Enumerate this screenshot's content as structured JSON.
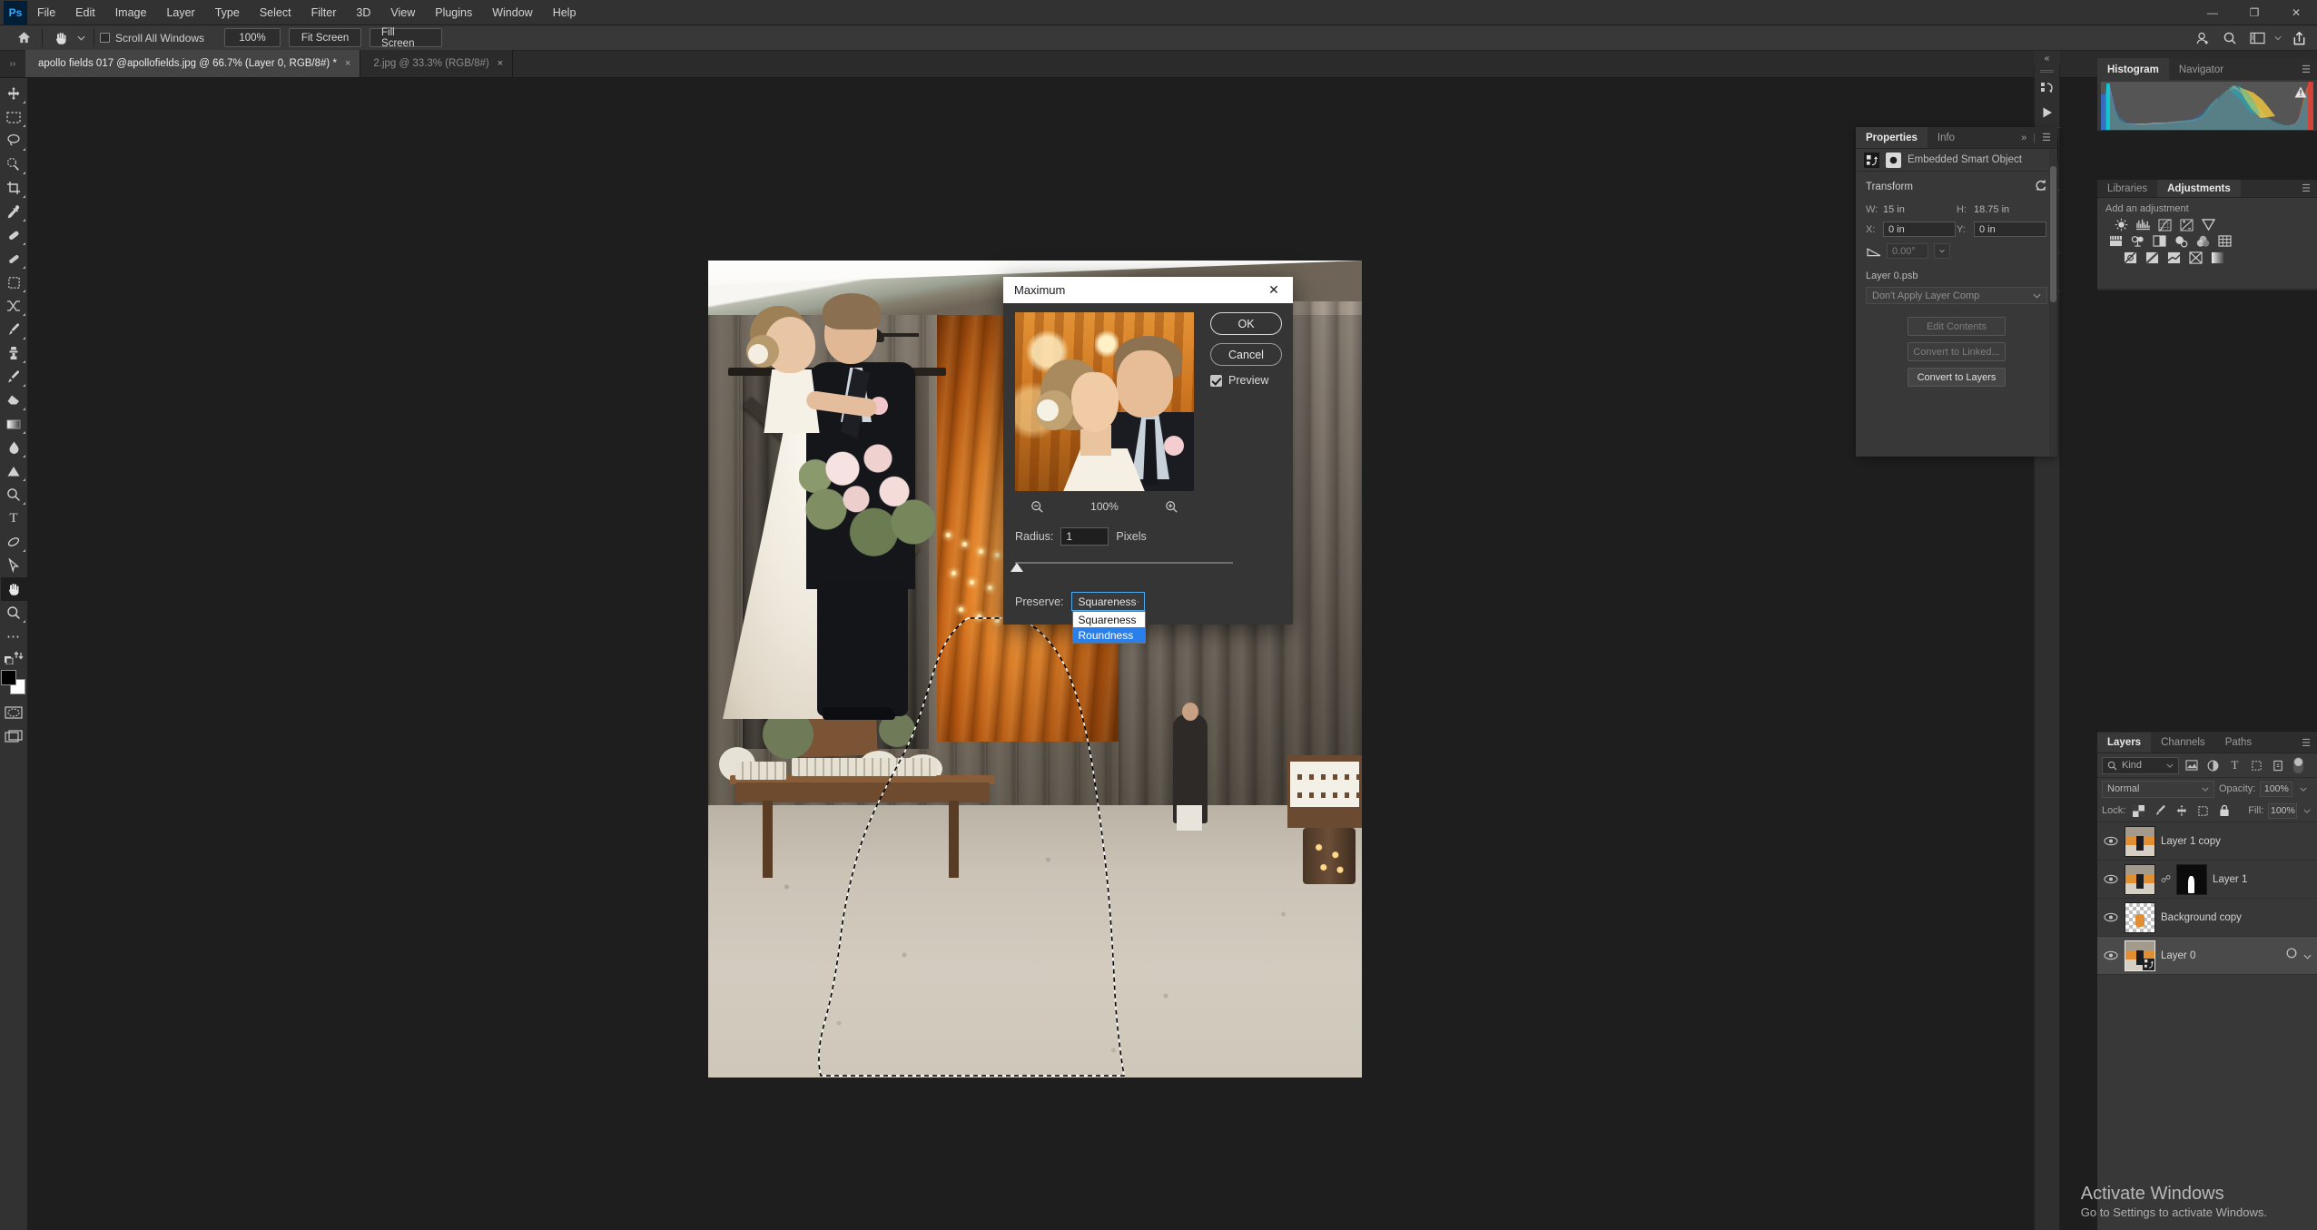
{
  "app": {
    "logo": "Ps"
  },
  "menubar": {
    "items": [
      "File",
      "Edit",
      "Image",
      "Layer",
      "Type",
      "Select",
      "Filter",
      "3D",
      "View",
      "Plugins",
      "Window",
      "Help"
    ],
    "window_controls": [
      "minimize-icon",
      "restore-icon",
      "close-icon"
    ]
  },
  "options_bar": {
    "home_icon": "home-icon",
    "tool_icon": "hand-tool-icon",
    "tool_preset_chevron": "chevron-down-icon",
    "scroll_all_windows_label": "Scroll All Windows",
    "scroll_all_windows_checked": false,
    "zoom_button": "100%",
    "fit_screen_button": "Fit Screen",
    "fill_screen_button": "Fill Screen",
    "right_icons": [
      "add-user-icon",
      "search-icon",
      "workspace-icon",
      "chevron-down-icon",
      "share-icon"
    ]
  },
  "tabs": [
    {
      "label": "apollo fields 017 @apollofields.jpg @ 66.7% (Layer 0, RGB/8#) *",
      "active": true,
      "close": "×"
    },
    {
      "label": "2.jpg @ 33.3% (RGB/8#)",
      "active": false,
      "close": "×"
    }
  ],
  "toolbar": {
    "tools": [
      {
        "name": "move-tool",
        "glyph": "✛"
      },
      {
        "name": "rectangular-marquee-tool",
        "glyph": "⬚"
      },
      {
        "name": "lasso-tool",
        "glyph": "❀"
      },
      {
        "name": "object-selection-tool",
        "glyph": "⭔"
      },
      {
        "name": "crop-tool",
        "glyph": "⌧"
      },
      {
        "name": "eyedropper-tool",
        "glyph": "✒"
      },
      {
        "name": "spot-healing-brush-tool",
        "glyph": "✐"
      },
      {
        "name": "patch-tool",
        "glyph": "▰"
      },
      {
        "name": "frame-tool",
        "glyph": "⬛"
      },
      {
        "name": "shuffle-tool",
        "glyph": "✂"
      },
      {
        "name": "brush-tool",
        "glyph": "✑"
      },
      {
        "name": "clone-stamp-tool",
        "glyph": "⚑"
      },
      {
        "name": "history-brush-tool",
        "glyph": "✒"
      },
      {
        "name": "eraser-tool",
        "glyph": "◢"
      },
      {
        "name": "gradient-tool",
        "glyph": "▭"
      },
      {
        "name": "blur-tool",
        "glyph": "●"
      },
      {
        "name": "dodge-tool",
        "glyph": "▲"
      },
      {
        "name": "pen-tool",
        "glyph": "✒"
      },
      {
        "name": "type-tool",
        "glyph": "T"
      },
      {
        "name": "path-selection-tool",
        "glyph": "↗"
      },
      {
        "name": "direct-selection-tool",
        "glyph": "➤"
      },
      {
        "name": "hand-tool",
        "glyph": "✋",
        "selected": true
      },
      {
        "name": "zoom-tool",
        "glyph": "⌕"
      },
      {
        "name": "edit-toolbar-tool",
        "glyph": "⋯"
      },
      {
        "name": "default-colors-tool",
        "glyph": "⇄"
      }
    ],
    "foreground_color": "#000000",
    "background_color": "#ffffff",
    "quick_mask_icon": "quick-mask-icon",
    "screen_mode_icon": "screen-mode-icon"
  },
  "canvas": {
    "document_title": "apollo fields 017 @apollofields.jpg",
    "zoom": "66.7%",
    "selection_active": true
  },
  "dialog": {
    "title": "Maximum",
    "close": "✕",
    "ok_label": "OK",
    "cancel_label": "Cancel",
    "preview_label": "Preview",
    "preview_checked": true,
    "zoom_out_icon": "zoom-out-icon",
    "zoom_in_icon": "zoom-in-icon",
    "zoom_value": "100%",
    "radius_label": "Radius:",
    "radius_value": "1",
    "radius_units": "Pixels",
    "preserve_label": "Preserve:",
    "preserve_value": "Squareness",
    "preserve_options": [
      {
        "label": "Squareness",
        "highlighted": false
      },
      {
        "label": "Roundness",
        "highlighted": true
      }
    ],
    "highlight_color": "#2a7fea"
  },
  "icon_rail": {
    "collapse_icon": "collapse-panels-icon",
    "groups": [
      [
        "history-icon",
        "play-icon"
      ],
      [
        "adjustments-icon",
        "info-icon"
      ],
      [
        "brush-settings-icon",
        "tool-presets-icon"
      ],
      [
        "clone-source-icon"
      ],
      [
        "libraries-icon"
      ]
    ]
  },
  "properties_panel": {
    "tabs": [
      {
        "label": "Properties",
        "active": true
      },
      {
        "label": "Info",
        "active": false
      }
    ],
    "collapse_icon": "chevron-right-icon",
    "menu_icon": "panel-menu-icon",
    "object_type_label": "Embedded Smart Object",
    "smart_object_icon": "smart-object-icon",
    "mask_icon": "layer-mask-icon",
    "transform_title": "Transform",
    "reset_icon": "reset-icon",
    "w_label": "W:",
    "w_value": "15 in",
    "h_label": "H:",
    "h_value": "18.75 in",
    "x_label": "X:",
    "x_value": "0 in",
    "y_label": "Y:",
    "y_value": "0 in",
    "angle_icon": "angle-icon",
    "angle_value": "0.00°",
    "psb_label": "Layer 0.psb",
    "layer_comp_value": "Don't Apply Layer Comp",
    "buttons": [
      {
        "label": "Edit Contents",
        "enabled": false
      },
      {
        "label": "Convert to Linked...",
        "enabled": false
      },
      {
        "label": "Convert to Layers",
        "enabled": true
      }
    ]
  },
  "histogram_panel": {
    "tabs": [
      {
        "label": "Histogram",
        "active": true
      },
      {
        "label": "Navigator",
        "active": false
      }
    ],
    "menu_icon": "panel-menu-icon",
    "warning_icon": "cached-data-warning-icon"
  },
  "adjustments_panel": {
    "tabs": [
      {
        "label": "Libraries",
        "active": false
      },
      {
        "label": "Adjustments",
        "active": true
      }
    ],
    "menu_icon": "panel-menu-icon",
    "prompt": "Add an adjustment",
    "row1": [
      "brightness-contrast-icon",
      "levels-icon",
      "curves-icon",
      "exposure-icon",
      "vibrance-icon"
    ],
    "row2": [
      "hue-saturation-icon",
      "color-balance-icon",
      "black-white-icon",
      "photo-filter-icon",
      "channel-mixer-icon",
      "color-lookup-icon"
    ],
    "row3": [
      "invert-icon",
      "posterize-icon",
      "threshold-icon",
      "selective-color-icon",
      "gradient-map-icon"
    ]
  },
  "layers_panel": {
    "tabs": [
      {
        "label": "Layers",
        "active": true
      },
      {
        "label": "Channels",
        "active": false
      },
      {
        "label": "Paths",
        "active": false
      }
    ],
    "menu_icon": "panel-menu-icon",
    "filter_kind_label": "Kind",
    "filter_search_icon": "search-icon",
    "filter_icons": [
      "pixel-filter-icon",
      "adjustment-filter-icon",
      "type-filter-icon",
      "shape-filter-icon",
      "smart-object-filter-icon"
    ],
    "filter_toggle_icon": "filter-toggle-icon",
    "blend_mode": "Normal",
    "opacity_label": "Opacity:",
    "opacity_value": "100%",
    "lock_label": "Lock:",
    "lock_icons": [
      "lock-transparency-icon",
      "lock-image-icon",
      "lock-position-icon",
      "lock-artboard-icon",
      "lock-all-icon"
    ],
    "fill_label": "Fill:",
    "fill_value": "100%",
    "layers": [
      {
        "name": "Layer 1 copy",
        "visible": true,
        "selected": false,
        "has_mask": false,
        "kind": "image"
      },
      {
        "name": "Layer 1",
        "visible": true,
        "selected": false,
        "has_mask": true,
        "kind": "image"
      },
      {
        "name": "Background copy",
        "visible": true,
        "selected": false,
        "has_mask": false,
        "kind": "transparent"
      },
      {
        "name": "Layer 0",
        "visible": true,
        "selected": true,
        "has_mask": false,
        "kind": "smart-object"
      }
    ]
  },
  "watermark": {
    "title": "Activate Windows",
    "subtitle": "Go to Settings to activate Windows."
  }
}
